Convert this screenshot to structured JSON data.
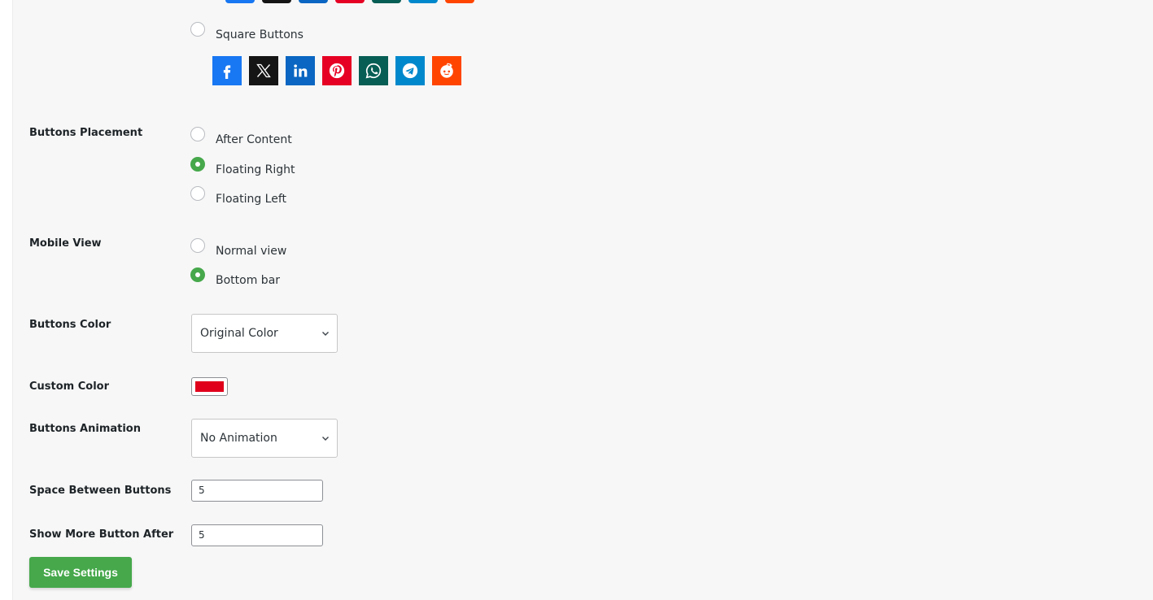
{
  "button_style": {
    "square_label": "Square Buttons",
    "square_selected": false
  },
  "share_buttons": [
    {
      "name": "facebook-icon",
      "color": "#1877f2"
    },
    {
      "name": "x-icon",
      "color": "#151515"
    },
    {
      "name": "linkedin-icon",
      "color": "#0a66c2"
    },
    {
      "name": "pinterest-icon",
      "color": "#e60023"
    },
    {
      "name": "whatsapp-icon",
      "color": "#075e54"
    },
    {
      "name": "telegram-icon",
      "color": "#0088cc"
    },
    {
      "name": "reddit-icon",
      "color": "#ff4500"
    }
  ],
  "placement": {
    "label": "Buttons Placement",
    "options": [
      "After Content",
      "Floating Right",
      "Floating Left"
    ],
    "selected": "Floating Right"
  },
  "mobile_view": {
    "label": "Mobile View",
    "options": [
      "Normal view",
      "Bottom bar"
    ],
    "selected": "Bottom bar"
  },
  "buttons_color": {
    "label": "Buttons Color",
    "value": "Original Color"
  },
  "custom_color": {
    "label": "Custom Color",
    "value": "#e0001b"
  },
  "animation": {
    "label": "Buttons Animation",
    "value": "No Animation"
  },
  "space_between": {
    "label": "Space Between Buttons",
    "value": "5"
  },
  "show_more_after": {
    "label": "Show More Button After",
    "value": "5"
  },
  "save_label": "Save Settings",
  "accent_color": "#46a84b"
}
